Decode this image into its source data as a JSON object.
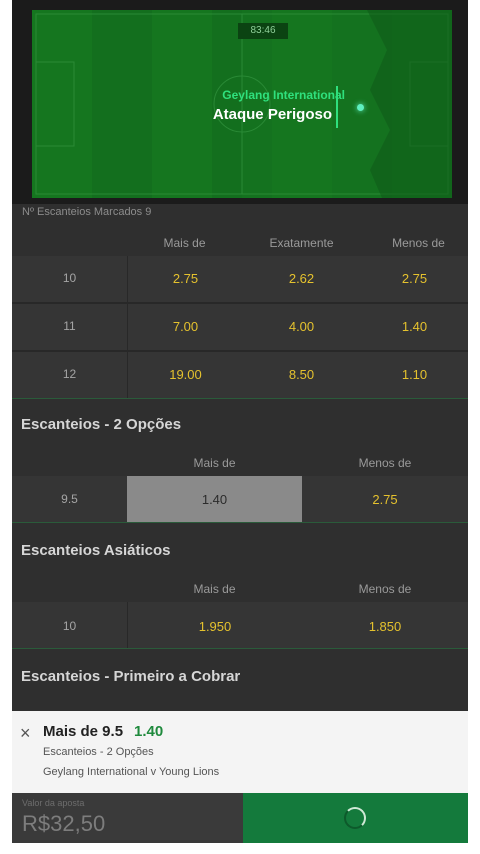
{
  "live_pitch": {
    "clock": "83:46",
    "team": "Geylang International",
    "event": "Ataque Perigoso"
  },
  "corners_marked": "Nº Escanteios Marcados 9",
  "corners_table": {
    "headers": [
      "Mais de",
      "Exatamente",
      "Menos de"
    ],
    "rows": [
      {
        "line": "10",
        "over": "2.75",
        "exact": "2.62",
        "under": "2.75"
      },
      {
        "line": "11",
        "over": "7.00",
        "exact": "4.00",
        "under": "1.40"
      },
      {
        "line": "12",
        "over": "19.00",
        "exact": "8.50",
        "under": "1.10"
      }
    ]
  },
  "corners_2way": {
    "title": "Escanteios - 2 Opções",
    "headers": [
      "Mais de",
      "Menos de"
    ],
    "row": {
      "line": "9.5",
      "over": "1.40",
      "under": "2.75"
    }
  },
  "asian_corners": {
    "title": "Escanteios Asiáticos",
    "headers": [
      "Mais de",
      "Menos de"
    ],
    "row": {
      "line": "10",
      "over": "1.950",
      "under": "1.850"
    }
  },
  "first_corner": {
    "title": "Escanteios - Primeiro a Cobrar"
  },
  "betslip": {
    "close_icon": "×",
    "selection": "Mais de 9.5",
    "odd": "1.40",
    "market": "Escanteios - 2 Opções",
    "event": "Geylang International v Young Lions"
  },
  "stake": {
    "label": "Valor da aposta",
    "value": "R$32,50"
  },
  "colors": {
    "pitch": "#14721f",
    "accent_green": "#2fe07d",
    "odds_yellow": "#e5c22e",
    "button_green": "#147a3c"
  }
}
